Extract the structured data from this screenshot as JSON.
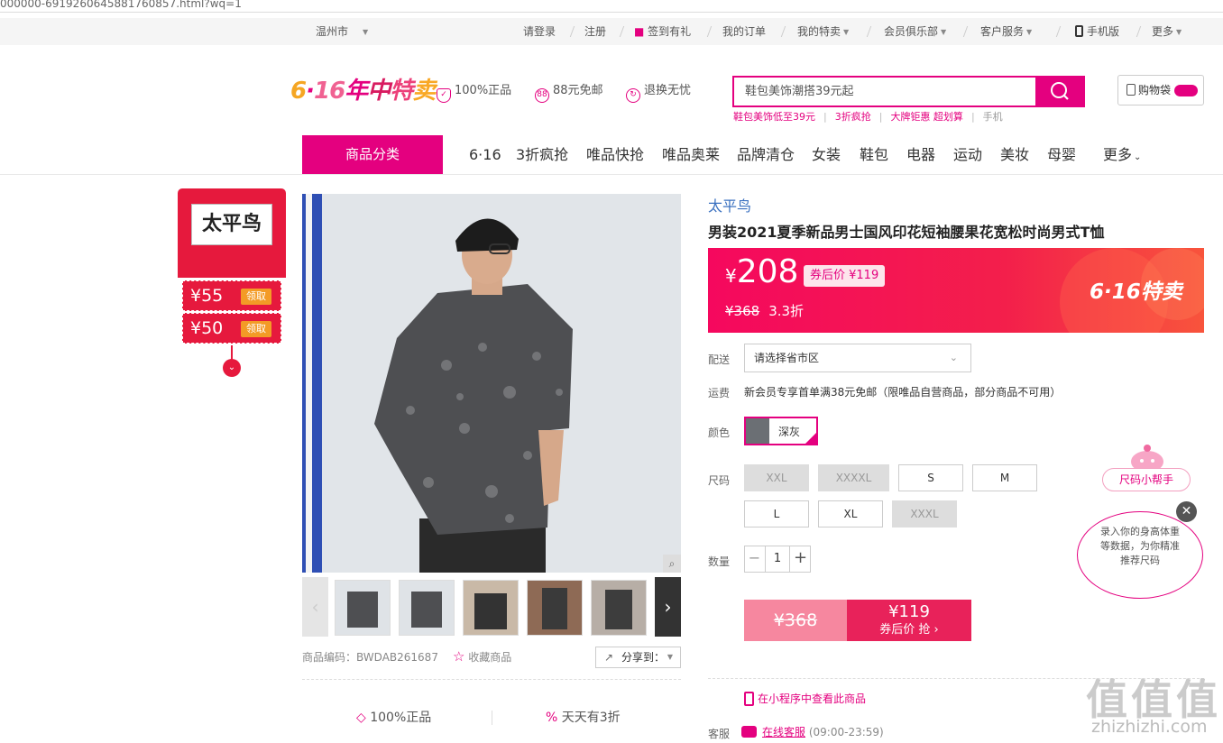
{
  "url": "000000-6919260645881760857.html?wq=1",
  "topbar": {
    "city": "温州市",
    "login": "请登录",
    "register": "注册",
    "checkin": "签到有礼",
    "orders": "我的订单",
    "my_vip": "我的特卖",
    "club": "会员俱乐部",
    "service": "客户服务",
    "mobile": "手机版",
    "more": "更多"
  },
  "header": {
    "logo": "6·16年中特卖",
    "feature_genuine": "100%正品",
    "feature_shipping": "88元免邮",
    "feature_return": "退换无忧",
    "search_placeholder": "鞋包美饰潮搭39元起",
    "cart": "购物袋",
    "hotwords": [
      "鞋包美饰低至39元",
      "3折疯抢",
      "大牌钜惠 超划算",
      "手机"
    ]
  },
  "nav": {
    "category": "商品分类",
    "items": [
      "6·16",
      "3折疯抢",
      "唯品快抢",
      "唯品奥莱",
      "品牌清仓",
      "女装",
      "鞋包",
      "电器",
      "运动",
      "美妆",
      "母婴",
      "更多"
    ]
  },
  "left_widget": {
    "brand": "太平鸟",
    "coupons": [
      {
        "amount": "¥55",
        "action": "领取"
      },
      {
        "amount": "¥50",
        "action": "领取"
      }
    ]
  },
  "product": {
    "brand": "太平鸟",
    "title": "男装2021夏季新品男士国风印花短袖腰果花宽松时尚男式T恤",
    "currency": "¥",
    "price": "208",
    "after_coupon": "券后价 ¥119",
    "orig_price": "¥368",
    "discount": "3.3折",
    "promo": "6·16特卖",
    "sku": "商品编码：BWDAB261687",
    "favorite": "收藏商品",
    "share": "分享到：",
    "guarantee_genuine": "100%正品",
    "guarantee_daily": "天天有3折"
  },
  "options": {
    "delivery_label": "配送",
    "region_placeholder": "请选择省市区",
    "shipping_label": "运费",
    "shipping_text": "新会员专享首单满38元免邮（限唯品自营商品，部分商品不可用）",
    "color_label": "颜色",
    "color": "深灰",
    "size_label": "尺码",
    "sizes": [
      {
        "label": "XXL",
        "available": false
      },
      {
        "label": "XXXXL",
        "available": false
      },
      {
        "label": "S",
        "available": true
      },
      {
        "label": "M",
        "available": true
      },
      {
        "label": "L",
        "available": true
      },
      {
        "label": "XL",
        "available": true
      },
      {
        "label": "XXXL",
        "available": false
      }
    ],
    "qty_label": "数量",
    "qty": "1"
  },
  "buy": {
    "orig": "¥368",
    "coupon_price": "¥119",
    "coupon_text": "券后价 抢 ›"
  },
  "extra": {
    "miniprogram": "在小程序中查看此商品",
    "cs_label": "客服",
    "cs_link": "在线客服",
    "cs_hours": "(09:00-23:59)"
  },
  "size_helper": {
    "title": "尺码小帮手",
    "bubble": "录入你的身高体重等数据，为你精准推荐尺码"
  },
  "watermark": {
    "main": "值值值",
    "sub": "zhizhizhi.com"
  },
  "colors": {
    "accent": "#e4007f",
    "price_bg": "#f31f4b",
    "coupon_red": "#e6193d",
    "brand_blue": "#3b71c0"
  }
}
